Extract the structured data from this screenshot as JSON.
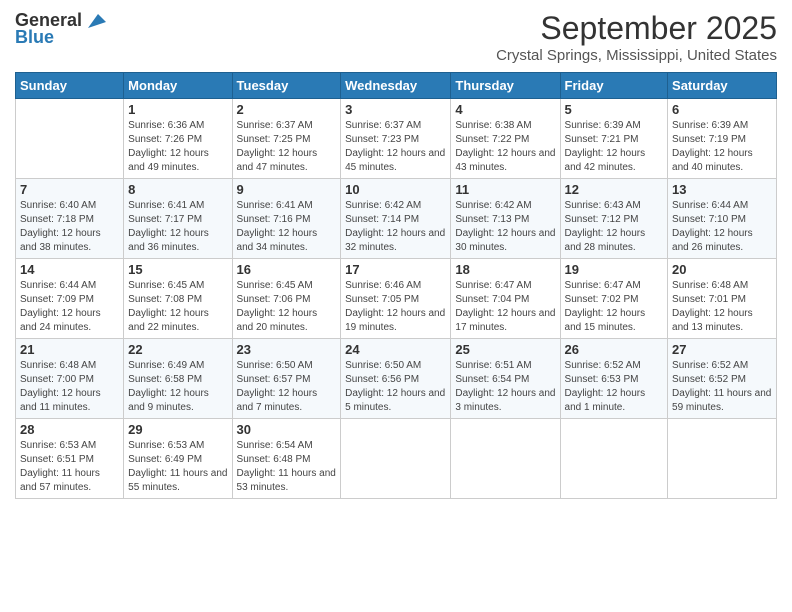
{
  "logo": {
    "general": "General",
    "blue": "Blue"
  },
  "header": {
    "title": "September 2025",
    "subtitle": "Crystal Springs, Mississippi, United States"
  },
  "weekdays": [
    "Sunday",
    "Monday",
    "Tuesday",
    "Wednesday",
    "Thursday",
    "Friday",
    "Saturday"
  ],
  "weeks": [
    [
      {
        "day": "",
        "sunrise": "",
        "sunset": "",
        "daylight": ""
      },
      {
        "day": "1",
        "sunrise": "Sunrise: 6:36 AM",
        "sunset": "Sunset: 7:26 PM",
        "daylight": "Daylight: 12 hours and 49 minutes."
      },
      {
        "day": "2",
        "sunrise": "Sunrise: 6:37 AM",
        "sunset": "Sunset: 7:25 PM",
        "daylight": "Daylight: 12 hours and 47 minutes."
      },
      {
        "day": "3",
        "sunrise": "Sunrise: 6:37 AM",
        "sunset": "Sunset: 7:23 PM",
        "daylight": "Daylight: 12 hours and 45 minutes."
      },
      {
        "day": "4",
        "sunrise": "Sunrise: 6:38 AM",
        "sunset": "Sunset: 7:22 PM",
        "daylight": "Daylight: 12 hours and 43 minutes."
      },
      {
        "day": "5",
        "sunrise": "Sunrise: 6:39 AM",
        "sunset": "Sunset: 7:21 PM",
        "daylight": "Daylight: 12 hours and 42 minutes."
      },
      {
        "day": "6",
        "sunrise": "Sunrise: 6:39 AM",
        "sunset": "Sunset: 7:19 PM",
        "daylight": "Daylight: 12 hours and 40 minutes."
      }
    ],
    [
      {
        "day": "7",
        "sunrise": "Sunrise: 6:40 AM",
        "sunset": "Sunset: 7:18 PM",
        "daylight": "Daylight: 12 hours and 38 minutes."
      },
      {
        "day": "8",
        "sunrise": "Sunrise: 6:41 AM",
        "sunset": "Sunset: 7:17 PM",
        "daylight": "Daylight: 12 hours and 36 minutes."
      },
      {
        "day": "9",
        "sunrise": "Sunrise: 6:41 AM",
        "sunset": "Sunset: 7:16 PM",
        "daylight": "Daylight: 12 hours and 34 minutes."
      },
      {
        "day": "10",
        "sunrise": "Sunrise: 6:42 AM",
        "sunset": "Sunset: 7:14 PM",
        "daylight": "Daylight: 12 hours and 32 minutes."
      },
      {
        "day": "11",
        "sunrise": "Sunrise: 6:42 AM",
        "sunset": "Sunset: 7:13 PM",
        "daylight": "Daylight: 12 hours and 30 minutes."
      },
      {
        "day": "12",
        "sunrise": "Sunrise: 6:43 AM",
        "sunset": "Sunset: 7:12 PM",
        "daylight": "Daylight: 12 hours and 28 minutes."
      },
      {
        "day": "13",
        "sunrise": "Sunrise: 6:44 AM",
        "sunset": "Sunset: 7:10 PM",
        "daylight": "Daylight: 12 hours and 26 minutes."
      }
    ],
    [
      {
        "day": "14",
        "sunrise": "Sunrise: 6:44 AM",
        "sunset": "Sunset: 7:09 PM",
        "daylight": "Daylight: 12 hours and 24 minutes."
      },
      {
        "day": "15",
        "sunrise": "Sunrise: 6:45 AM",
        "sunset": "Sunset: 7:08 PM",
        "daylight": "Daylight: 12 hours and 22 minutes."
      },
      {
        "day": "16",
        "sunrise": "Sunrise: 6:45 AM",
        "sunset": "Sunset: 7:06 PM",
        "daylight": "Daylight: 12 hours and 20 minutes."
      },
      {
        "day": "17",
        "sunrise": "Sunrise: 6:46 AM",
        "sunset": "Sunset: 7:05 PM",
        "daylight": "Daylight: 12 hours and 19 minutes."
      },
      {
        "day": "18",
        "sunrise": "Sunrise: 6:47 AM",
        "sunset": "Sunset: 7:04 PM",
        "daylight": "Daylight: 12 hours and 17 minutes."
      },
      {
        "day": "19",
        "sunrise": "Sunrise: 6:47 AM",
        "sunset": "Sunset: 7:02 PM",
        "daylight": "Daylight: 12 hours and 15 minutes."
      },
      {
        "day": "20",
        "sunrise": "Sunrise: 6:48 AM",
        "sunset": "Sunset: 7:01 PM",
        "daylight": "Daylight: 12 hours and 13 minutes."
      }
    ],
    [
      {
        "day": "21",
        "sunrise": "Sunrise: 6:48 AM",
        "sunset": "Sunset: 7:00 PM",
        "daylight": "Daylight: 12 hours and 11 minutes."
      },
      {
        "day": "22",
        "sunrise": "Sunrise: 6:49 AM",
        "sunset": "Sunset: 6:58 PM",
        "daylight": "Daylight: 12 hours and 9 minutes."
      },
      {
        "day": "23",
        "sunrise": "Sunrise: 6:50 AM",
        "sunset": "Sunset: 6:57 PM",
        "daylight": "Daylight: 12 hours and 7 minutes."
      },
      {
        "day": "24",
        "sunrise": "Sunrise: 6:50 AM",
        "sunset": "Sunset: 6:56 PM",
        "daylight": "Daylight: 12 hours and 5 minutes."
      },
      {
        "day": "25",
        "sunrise": "Sunrise: 6:51 AM",
        "sunset": "Sunset: 6:54 PM",
        "daylight": "Daylight: 12 hours and 3 minutes."
      },
      {
        "day": "26",
        "sunrise": "Sunrise: 6:52 AM",
        "sunset": "Sunset: 6:53 PM",
        "daylight": "Daylight: 12 hours and 1 minute."
      },
      {
        "day": "27",
        "sunrise": "Sunrise: 6:52 AM",
        "sunset": "Sunset: 6:52 PM",
        "daylight": "Daylight: 11 hours and 59 minutes."
      }
    ],
    [
      {
        "day": "28",
        "sunrise": "Sunrise: 6:53 AM",
        "sunset": "Sunset: 6:51 PM",
        "daylight": "Daylight: 11 hours and 57 minutes."
      },
      {
        "day": "29",
        "sunrise": "Sunrise: 6:53 AM",
        "sunset": "Sunset: 6:49 PM",
        "daylight": "Daylight: 11 hours and 55 minutes."
      },
      {
        "day": "30",
        "sunrise": "Sunrise: 6:54 AM",
        "sunset": "Sunset: 6:48 PM",
        "daylight": "Daylight: 11 hours and 53 minutes."
      },
      {
        "day": "",
        "sunrise": "",
        "sunset": "",
        "daylight": ""
      },
      {
        "day": "",
        "sunrise": "",
        "sunset": "",
        "daylight": ""
      },
      {
        "day": "",
        "sunrise": "",
        "sunset": "",
        "daylight": ""
      },
      {
        "day": "",
        "sunrise": "",
        "sunset": "",
        "daylight": ""
      }
    ]
  ]
}
